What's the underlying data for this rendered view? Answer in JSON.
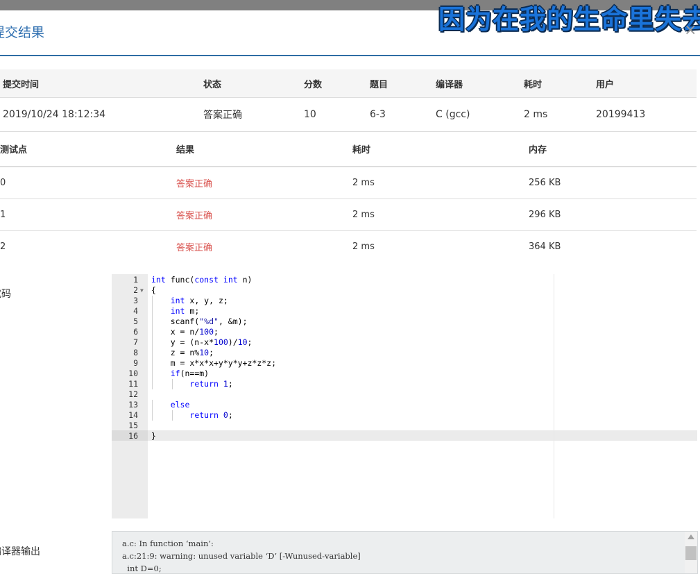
{
  "overlay_text": "因为在我的生命里失去",
  "dialog": {
    "title": "提交结果",
    "close_label": "×"
  },
  "submission": {
    "headers": [
      "提交时间",
      "状态",
      "分数",
      "题目",
      "编译器",
      "耗时",
      "用户"
    ],
    "row": [
      "2019/10/24 18:12:34",
      "答案正确",
      "10",
      "6-3",
      "C (gcc)",
      "2 ms",
      "20199413"
    ]
  },
  "testcases": {
    "headers": [
      "测试点",
      "结果",
      "耗时",
      "内存"
    ],
    "rows": [
      [
        "0",
        "答案正确",
        "2 ms",
        "256 KB"
      ],
      [
        "1",
        "答案正确",
        "2 ms",
        "296 KB"
      ],
      [
        "2",
        "答案正确",
        "2 ms",
        "364 KB"
      ]
    ]
  },
  "code_section": {
    "label": "代码",
    "lines": [
      "int func(const int n)",
      "{",
      "    int x, y, z;",
      "    int m;",
      "    scanf(\"%d\", &m);",
      "    x = n/100;",
      "    y = (n-x*100)/10;",
      "    z = n%10;",
      "    m = x*x*x+y*y*y+z*z*z;",
      "    if(n==m)",
      "        return 1;",
      "",
      "    else",
      "        return 0;",
      "",
      "}"
    ]
  },
  "compiler_output": {
    "label": "编译器输出",
    "text": "a.c: In function ‘main’:\na.c:21:9: warning: unused variable ‘D’ [-Wunused-variable]\n  int D=0;"
  }
}
